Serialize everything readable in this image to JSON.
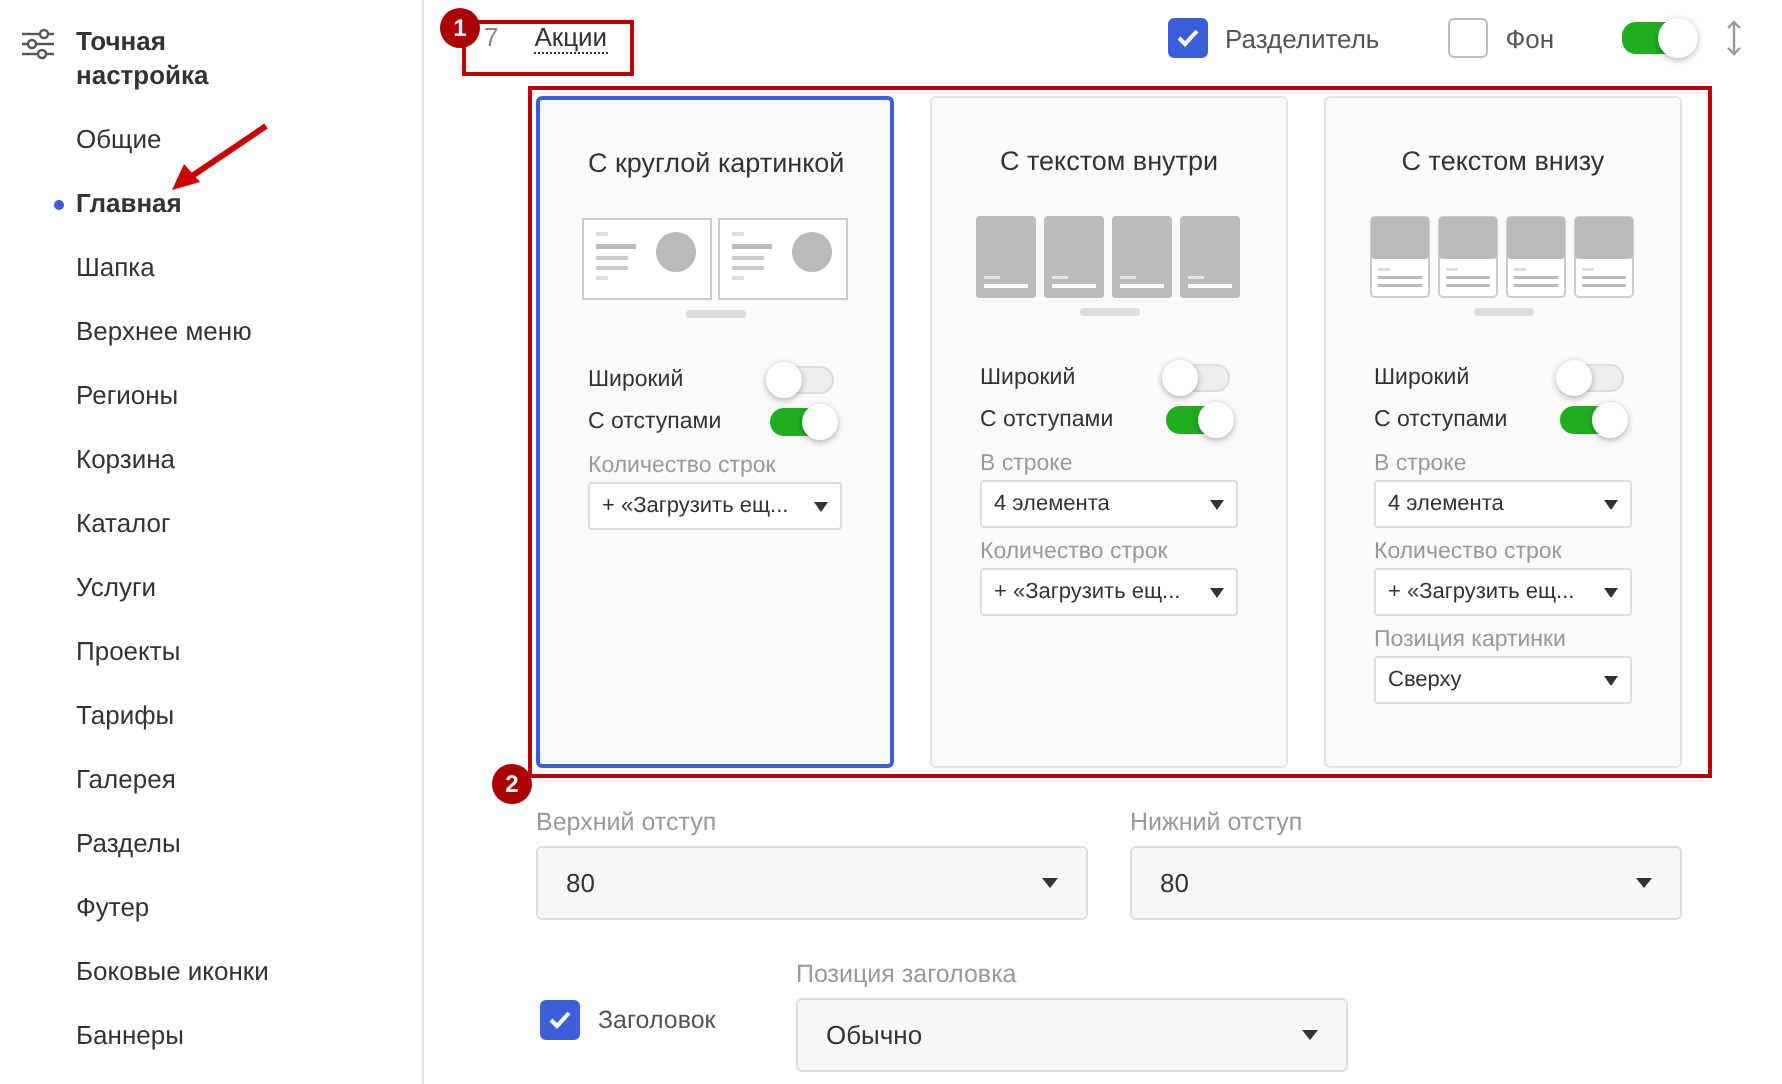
{
  "sidebar": {
    "title": "Точная настройка",
    "items": [
      {
        "label": "Общие",
        "selected": false
      },
      {
        "label": "Главная",
        "selected": true
      },
      {
        "label": "Шапка",
        "selected": false
      },
      {
        "label": "Верхнее меню",
        "selected": false
      },
      {
        "label": "Регионы",
        "selected": false
      },
      {
        "label": "Корзина",
        "selected": false
      },
      {
        "label": "Каталог",
        "selected": false
      },
      {
        "label": "Услуги",
        "selected": false
      },
      {
        "label": "Проекты",
        "selected": false
      },
      {
        "label": "Тарифы",
        "selected": false
      },
      {
        "label": "Галерея",
        "selected": false
      },
      {
        "label": "Разделы",
        "selected": false
      },
      {
        "label": "Футер",
        "selected": false
      },
      {
        "label": "Боковые иконки",
        "selected": false
      },
      {
        "label": "Баннеры",
        "selected": false
      }
    ]
  },
  "block": {
    "number": "7",
    "name": "Акции",
    "divider": {
      "label": "Разделитель",
      "checked": true
    },
    "background": {
      "label": "Фон",
      "checked": false
    },
    "enabled": true
  },
  "cards": [
    {
      "title": "С круглой картинкой",
      "selected": true,
      "kind": "round",
      "toggles": [
        {
          "label": "Широкий",
          "on": false
        },
        {
          "label": "С отступами",
          "on": true
        }
      ],
      "fields": [
        {
          "label": "Количество строк",
          "value": "+ «Загрузить ещ..."
        }
      ]
    },
    {
      "title": "С текстом внутри",
      "selected": false,
      "kind": "inside",
      "toggles": [
        {
          "label": "Широкий",
          "on": false
        },
        {
          "label": "С отступами",
          "on": true
        }
      ],
      "fields": [
        {
          "label": "В строке",
          "value": "4 элемента"
        },
        {
          "label": "Количество строк",
          "value": "+ «Загрузить ещ..."
        }
      ]
    },
    {
      "title": "С текстом внизу",
      "selected": false,
      "kind": "below",
      "toggles": [
        {
          "label": "Широкий",
          "on": false
        },
        {
          "label": "С отступами",
          "on": true
        }
      ],
      "fields": [
        {
          "label": "В строке",
          "value": "4 элемента"
        },
        {
          "label": "Количество строк",
          "value": "+ «Загрузить ещ..."
        },
        {
          "label": "Позиция картинки",
          "value": "Сверху"
        }
      ]
    }
  ],
  "padding": [
    {
      "label": "Верхний отступ",
      "value": "80"
    },
    {
      "label": "Нижний отступ",
      "value": "80"
    }
  ],
  "heading": {
    "label": "Заголовок",
    "checked": true
  },
  "heading_position": {
    "label": "Позиция заголовка",
    "value": "Обычно"
  },
  "annotations": [
    {
      "badge": "1"
    },
    {
      "badge": "2"
    }
  ]
}
